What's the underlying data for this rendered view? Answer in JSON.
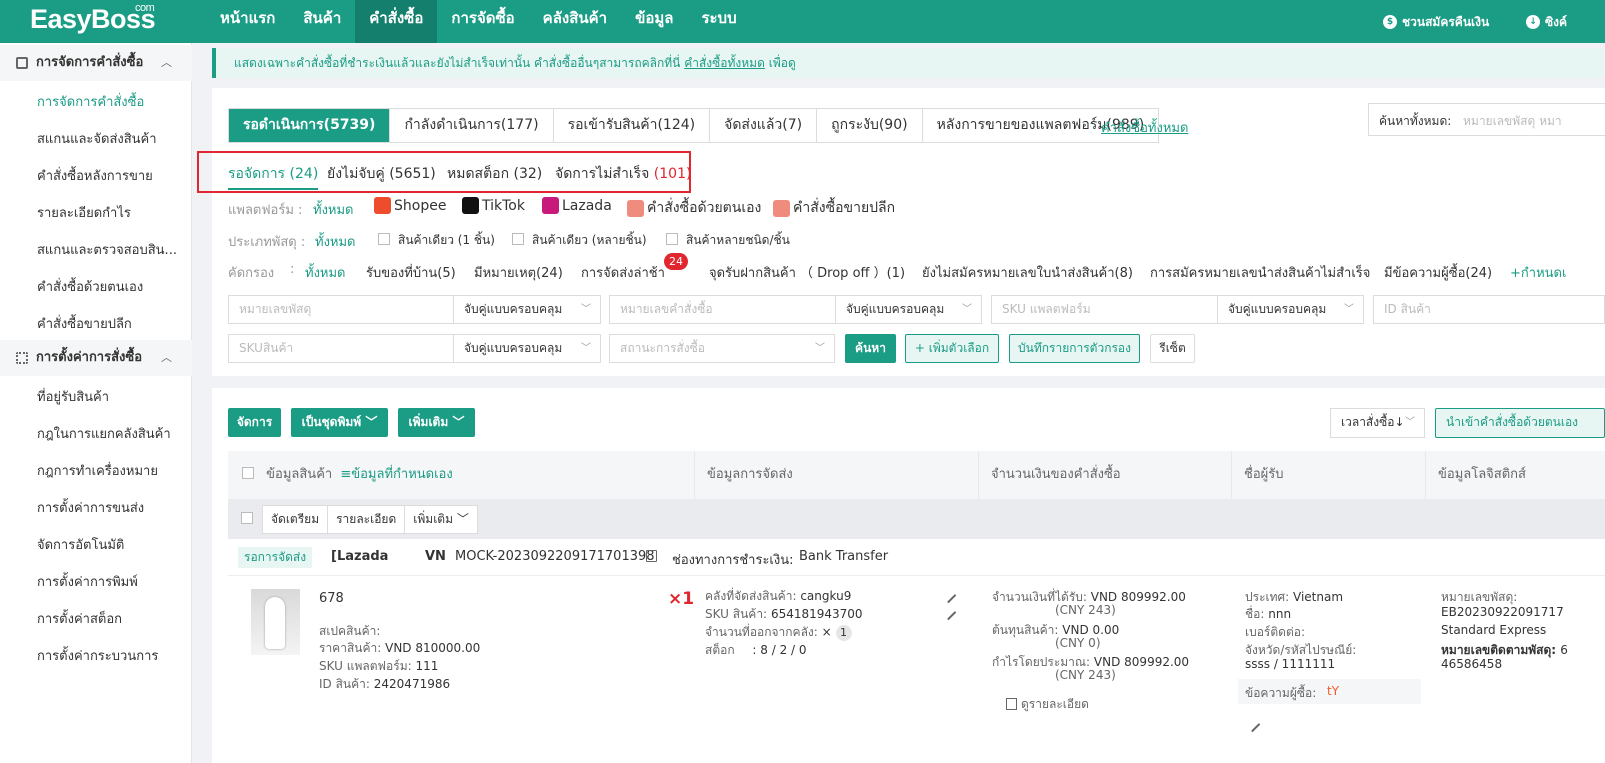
{
  "app": {
    "logo": "EasyBoss",
    "logo_sup": "com"
  },
  "nav": [
    "หน้าแรก",
    "สินค้า",
    "คำสั่งซื้อ",
    "การจัดซื้อ",
    "คลังสินค้า",
    "ข้อมูล",
    "ระบบ"
  ],
  "nav_active": 2,
  "topright": {
    "invite": "ชวนสมัครคืนเงิน",
    "sync": "ซิงค์"
  },
  "sidebar": {
    "group1": "การจัดการคำสั่งซื้อ",
    "group1_items": [
      "การจัดการคำสั่งซื้อ",
      "สแกนและจัดส่งสินค้า",
      "คำสั่งซื้อหลังการขาย",
      "รายละเอียดกำไร",
      "สแกนและตรวจสอบสิน...",
      "คำสั่งซื้อด้วยตนเอง",
      "คำสั่งซื้อขายปลีก"
    ],
    "group2": "การตั้งค่าการสั่งซื้อ",
    "group2_items": [
      "ที่อยู่รับสินค้า",
      "กฎในการแยกคลังสินค้า",
      "กฎการทำเครื่องหมาย",
      "การตั้งค่าการขนส่ง",
      "จัดการอัตโนมัติ",
      "การตั้งค่าการพิมพ์",
      "การตั้งค่าสต็อก",
      "การตั้งค่ากระบวนการ"
    ]
  },
  "notice": {
    "text": "แสดงเฉพาะคำสั่งซื้อที่ชำระเงินแล้วและยังไม่สำเร็จเท่านั้น คำสั่งซื้ออื่นๆสามารถคลิกที่นี่",
    "link": "คำสั่งซื้อทั้งหมด",
    "suffix": "เพื่อดู"
  },
  "tabs": [
    "รอดำเนินการ(5739)",
    "กำลังดำเนินการ(177)",
    "รอเข้ารับสินค้า(124)",
    "จัดส่งแล้ว(7)",
    "ถูกระงับ(90)",
    "หลังการขายของแพลตฟอร์ม(989)"
  ],
  "all_orders_link": "คำสั่งซื้อทั้งหมด",
  "search": {
    "label": "ค้นหาทั้งหมด:",
    "placeholder": "หมายเลขพัสดุ หมา"
  },
  "subtabs": [
    {
      "label": "รอจัดการ",
      "count": "(24)"
    },
    {
      "label": "ยังไม่จับคู่",
      "count": "(5651)"
    },
    {
      "label": "หมดสต็อก",
      "count": "(32)"
    },
    {
      "label": "จัดการไม่สำเร็จ",
      "count": "(101)"
    }
  ],
  "platform": {
    "label": "แพลตฟอร์ม :",
    "all": "ทั้งหมด",
    "items": [
      "Shopee",
      "TikTok",
      "Lazada",
      "คำสั่งซื้อด้วยตนเอง",
      "คำสั่งซื้อขายปลีก"
    ]
  },
  "parcel_type": {
    "label": "ประเภทพัสดุ :",
    "all": "ทั้งหมด",
    "items": [
      "สินค้าเดียว (1 ชิ้น)",
      "สินค้าเดียว (หลายชิ้น)",
      "สินค้าหลายชนิด/ชิ้น"
    ]
  },
  "filter": {
    "label": "คัดกรอง",
    "colon": ":",
    "all": "ทั้งหมด",
    "items": [
      "รับของที่บ้าน(5)",
      "มีหมายเหตุ(24)",
      "การจัดส่งล่าช้า",
      "จุดรับฝากสินค้า （ Drop off ）(1)",
      "ยังไม่สมัครหมายเลขใบนำส่งสินค้า(8)",
      "การสมัครหมายเลขนำส่งสินค้าไม่สำเร็จ",
      "มีข้อความผู้ซื้อ(24)",
      "+กำหนดเ"
    ],
    "late_badge": "24"
  },
  "form": {
    "parcel_no": "หมายเลขพัสดุ",
    "order_no": "หมายเลขคำสั่งซื้อ",
    "sku_platform": "SKU แพลตฟอร์ม",
    "product_id": "ID สินค้า",
    "sku_product": "SKUสินค้า",
    "order_status": "สถานะการสั่งซื้อ",
    "match_mode": "จับคู่แบบครอบคลุม",
    "search_btn": "ค้นหา",
    "add_option_btn": "+ เพิ่มตัวเลือก",
    "save_filter_btn": "บันทึกรายการตัวกรอง",
    "reset_btn": "รีเซ็ต"
  },
  "toolbar": {
    "process": "จัดการ",
    "print_set": "เป็นชุดพิมพ์",
    "more": "เพิ่มเติม",
    "sort": "เวลาสั่งซื้อ↓",
    "import": "นำเข้าคำสั่งซื้อด้วยตนเอง"
  },
  "table": {
    "headers": [
      "ข้อมูลสินค้า",
      "ข้อมูลการจัดส่ง",
      "จำนวนเงินของคำสั่งซื้อ",
      "ชื่อผู้รับ",
      "ข้อมูลโลจิสติกส์"
    ],
    "custom_info": "≡ข้อมูลที่กำหนดเอง",
    "sub_buttons": [
      "จัดเตรียม",
      "รายละเอียด",
      "เพิ่มเติม"
    ]
  },
  "order": {
    "status": "รอการจัดส่ง",
    "shop": "[Lazada",
    "country": "VN",
    "order_no": "MOCK-2023092209171701398",
    "payment_label": "ช่องทางการชำระเงิน:",
    "payment_value": "Bank Transfer",
    "product_name": "678",
    "spec_label": "สเปคสินค้า:",
    "price_label": "ราคาสินค้า:",
    "price_value": "VND 810000.00",
    "sku_pf_label": "SKU แพลตฟอร์ม:",
    "sku_pf_value": "111",
    "pid_label": "ID สินค้า:",
    "pid_value": "2420471986",
    "qty": "×1",
    "wh_label": "คลังที่จัดส่งสินค้า:",
    "wh_value": "cangku9",
    "sku_label": "SKU สินค้า:",
    "sku_value": "654181943700",
    "out_label": "จำนวนที่ออกจากคลัง:",
    "out_x": "×",
    "out_value": "1",
    "stock_label": "สต็อก",
    "stock_value": ": 8 / 2 / 0",
    "recv_label": "จำนวนเงินที่ได้รับ:",
    "recv_value": "VND 809992.00",
    "recv_cny": "(CNY 243)",
    "cost_label": "ต้นทุนสินค้า:",
    "cost_value": "VND 0.00",
    "cost_cny": "(CNY 0)",
    "profit_label": "กำไรโดยประมาณ:",
    "profit_value": "VND 809992.00",
    "profit_cny": "(CNY 243)",
    "detail_link": "ดูรายละเอียด",
    "country_label": "ประเทศ:",
    "country_value": "Vietnam",
    "name_label": "ชื่อ:",
    "name_value": "nnn",
    "phone_label": "เบอร์ติดต่อ:",
    "prov_label": "จังหวัด/รหัสไปรษณีย์:",
    "prov_value": "ssss / 1111111",
    "buyer_msg_label": "ข้อความผู้ซื้อ:",
    "buyer_msg_value": "tY",
    "track_label": "หมายเลขพัสดุ:",
    "track_value": "EB20230922091717",
    "carrier": "Standard Express",
    "follow_label": "หมายเลขติดตามพัสดุ:",
    "follow_value": "6",
    "follow_value2": "46586458"
  },
  "colors": {
    "brand": "#1a9c85",
    "brand_dark": "#137f6c",
    "alert": "#e0262f"
  }
}
